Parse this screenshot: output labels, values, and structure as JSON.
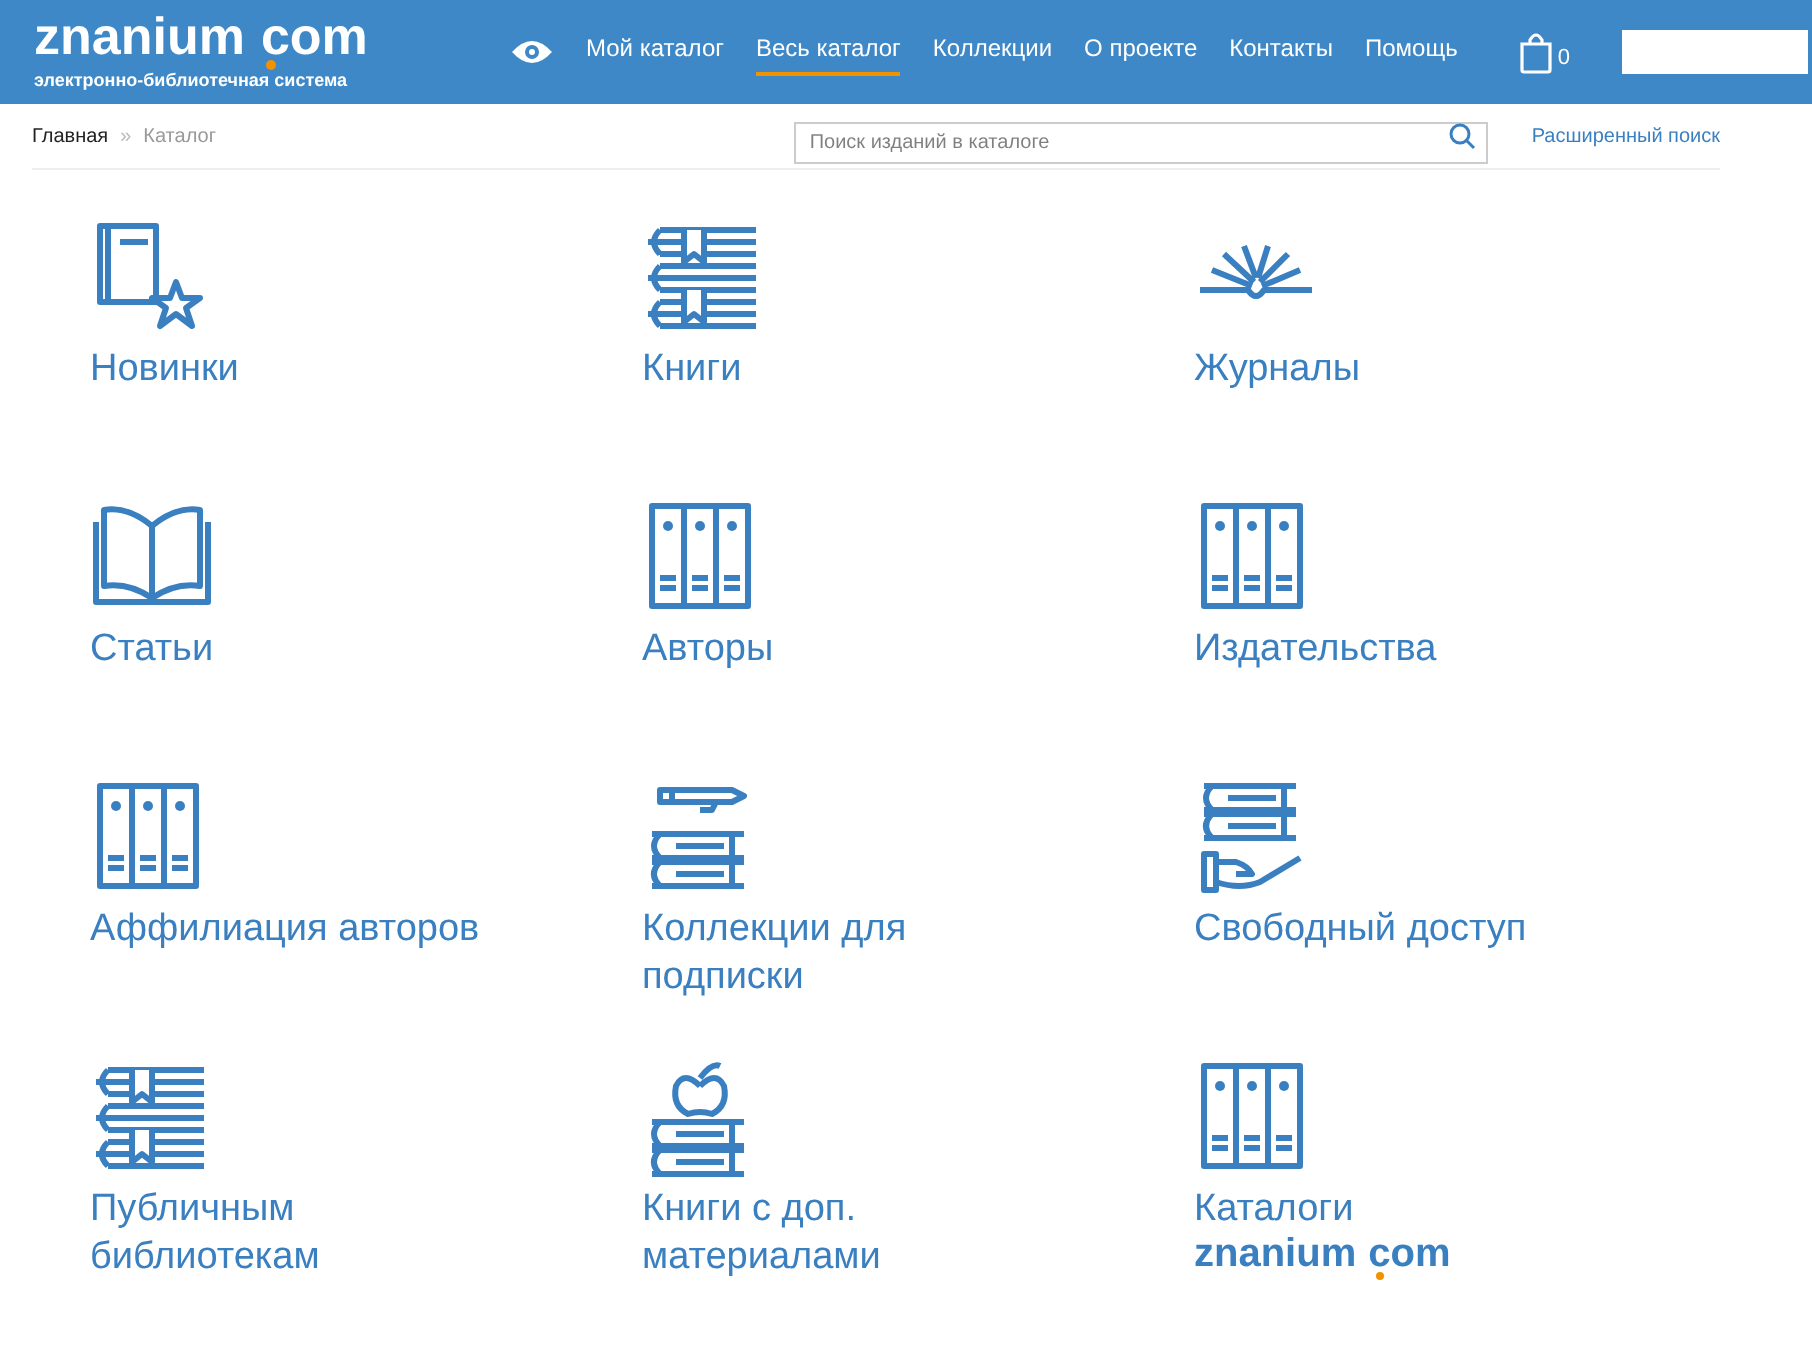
{
  "header": {
    "logo": {
      "name": "znanium",
      "domain": "com",
      "tagline": "электронно-библиотечная система"
    },
    "nav": [
      {
        "label": "Мой каталог",
        "selected": false
      },
      {
        "label": "Весь каталог",
        "selected": true
      },
      {
        "label": "Коллекции",
        "selected": false
      },
      {
        "label": "О проекте",
        "selected": false
      },
      {
        "label": "Контакты",
        "selected": false
      },
      {
        "label": "Помощь",
        "selected": false
      }
    ],
    "cart_count": "0"
  },
  "breadcrumb_separator": "»",
  "breadcrumbs": [
    {
      "label": "Главная",
      "current": false
    },
    {
      "label": "Каталог",
      "current": true
    }
  ],
  "search": {
    "placeholder": "Поиск изданий в каталоге"
  },
  "advanced_search": "Расширенный поиск",
  "tiles": [
    {
      "kind": "book-star",
      "label": "Новинки"
    },
    {
      "kind": "books-bookmark",
      "label": "Книги"
    },
    {
      "kind": "magazine",
      "label": "Журналы"
    },
    {
      "kind": "open-book",
      "label": "Статьи"
    },
    {
      "kind": "binders",
      "label": "Авторы"
    },
    {
      "kind": "binders",
      "label": "Издательства"
    },
    {
      "kind": "binders",
      "label": "Аффилиация авторов"
    },
    {
      "kind": "pen-books",
      "label": "Коллекции для подписки"
    },
    {
      "kind": "hand-books",
      "label": "Свободный доступ"
    },
    {
      "kind": "books-bookmark",
      "label": "Публичным библиотекам"
    },
    {
      "kind": "apple-books",
      "label": "Книги с доп. материалами"
    },
    {
      "kind": "binders",
      "label": "Каталоги",
      "logo": {
        "name": "znanium",
        "domain": "com"
      }
    }
  ]
}
